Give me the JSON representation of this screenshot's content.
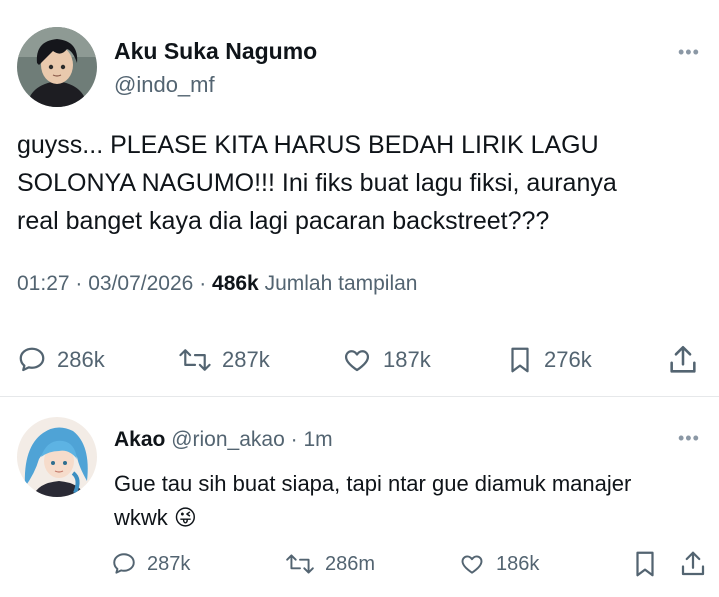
{
  "tweet": {
    "display_name": "Aku Suka Nagumo",
    "handle": "@indo_mf",
    "text_line1": "guyss... PLEASE KITA HARUS BEDAH LIRIK LAGU",
    "text_line2": "SOLONYA NAGUMO!!! Ini fiks buat lagu fiksi, auranya",
    "text_line3": "real banget kaya dia lagi pacaran backstreet???",
    "time": "01:27",
    "date": "03/07/2026",
    "views_count": "486k",
    "views_label": "Jumlah tampilan",
    "replies": "286k",
    "retweets": "287k",
    "likes": "187k",
    "bookmarks": "276k"
  },
  "reply": {
    "display_name": "Akao",
    "handle": "@rion_akao",
    "age": "1m",
    "text_line1": "Gue tau sih buat siapa, tapi ntar gue diamuk manajer",
    "text_line2": "wkwk",
    "emoji": "😜",
    "replies": "287k",
    "retweets": "286m",
    "likes": "186k"
  },
  "icons": {
    "reply": "speech-bubble-icon",
    "retweet": "retweet-icon",
    "like": "heart-icon",
    "bookmark": "bookmark-icon",
    "share": "share-icon",
    "more": "more-dots-icon"
  },
  "colors": {
    "text": "#0f1419",
    "muted": "#536471",
    "divider": "#e6e8ea"
  }
}
